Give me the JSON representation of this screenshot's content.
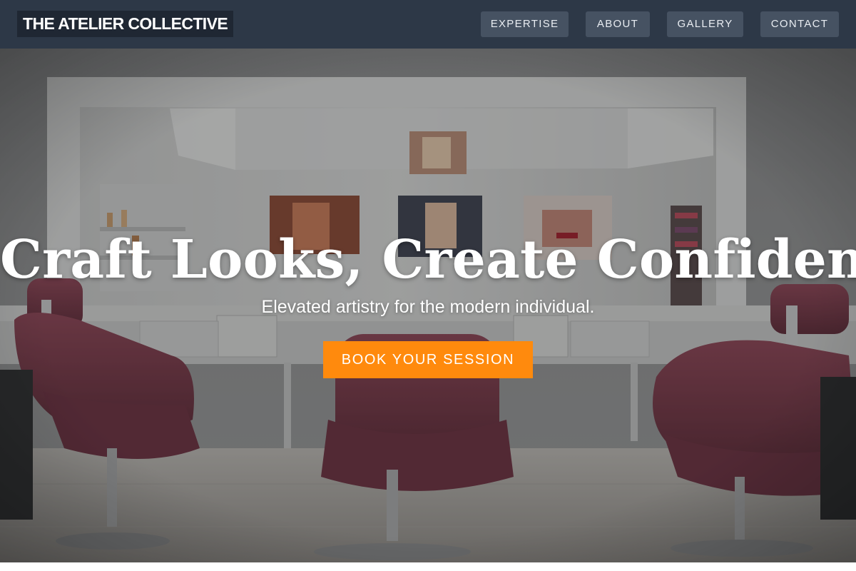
{
  "brand": {
    "name": "THE ATELIER COLLECTIVE"
  },
  "nav": {
    "items": [
      {
        "label": "EXPERTISE"
      },
      {
        "label": "ABOUT"
      },
      {
        "label": "GALLERY"
      },
      {
        "label": "CONTACT"
      }
    ]
  },
  "hero": {
    "title": "Craft Looks, Create Confidence.",
    "subtitle": "Elevated artistry for the modern individual.",
    "cta_label": "BOOK YOUR SESSION",
    "image_subject": "salon-interior-with-mirror-and-styling-chairs"
  },
  "colors": {
    "nav_background": "#2d3847",
    "nav_button": "#465262",
    "brand_background": "#1f2733",
    "cta_accent": "#ff8a0d",
    "chair_upholstery": "#7a3a47"
  }
}
